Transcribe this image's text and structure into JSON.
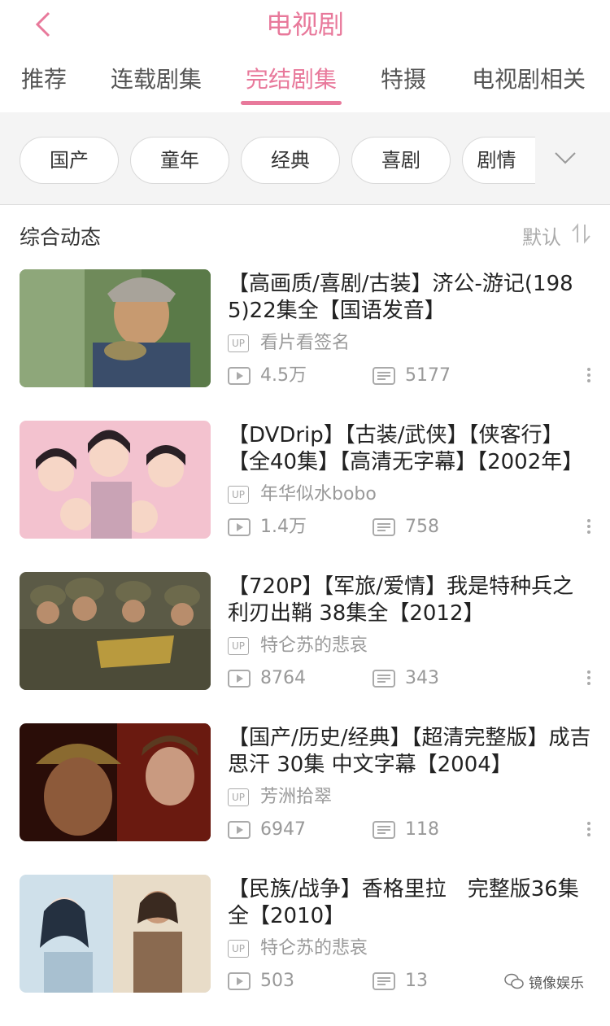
{
  "header": {
    "title": "电视剧",
    "tabs": [
      "推荐",
      "连载剧集",
      "完结剧集",
      "特摄",
      "电视剧相关"
    ],
    "active_tab": 2
  },
  "filters": {
    "chips": [
      "国产",
      "童年",
      "经典",
      "喜剧",
      "剧情"
    ]
  },
  "section": {
    "title": "综合动态",
    "sort_label": "默认"
  },
  "items": [
    {
      "title": "【高画质/喜剧/古装】济公-游记(1985)22集全【国语发音】",
      "up_badge": "UP",
      "uploader": "看片看签名",
      "plays": "4.5万",
      "danmaku": "5177"
    },
    {
      "title": "【DVDrip】【古装/武侠】【侠客行】【全40集】【高清无字幕】【2002年】",
      "up_badge": "UP",
      "uploader": "年华似水bobo",
      "plays": "1.4万",
      "danmaku": "758"
    },
    {
      "title": "【720P】【军旅/爱情】我是特种兵之利刃出鞘 38集全【2012】",
      "up_badge": "UP",
      "uploader": "特仑苏的悲哀",
      "plays": "8764",
      "danmaku": "343"
    },
    {
      "title": "【国产/历史/经典】【超清完整版】成吉思汗 30集 中文字幕【2004】",
      "up_badge": "UP",
      "uploader": "芳洲拾翠",
      "plays": "6947",
      "danmaku": "118"
    },
    {
      "title": "【民族/战争】香格里拉　完整版36集全【2010】",
      "up_badge": "UP",
      "uploader": "特仑苏的悲哀",
      "plays": "503",
      "danmaku": "13"
    }
  ],
  "watermark": "镜像娱乐",
  "colors": {
    "accent": "#e8799b",
    "muted": "#999999"
  }
}
